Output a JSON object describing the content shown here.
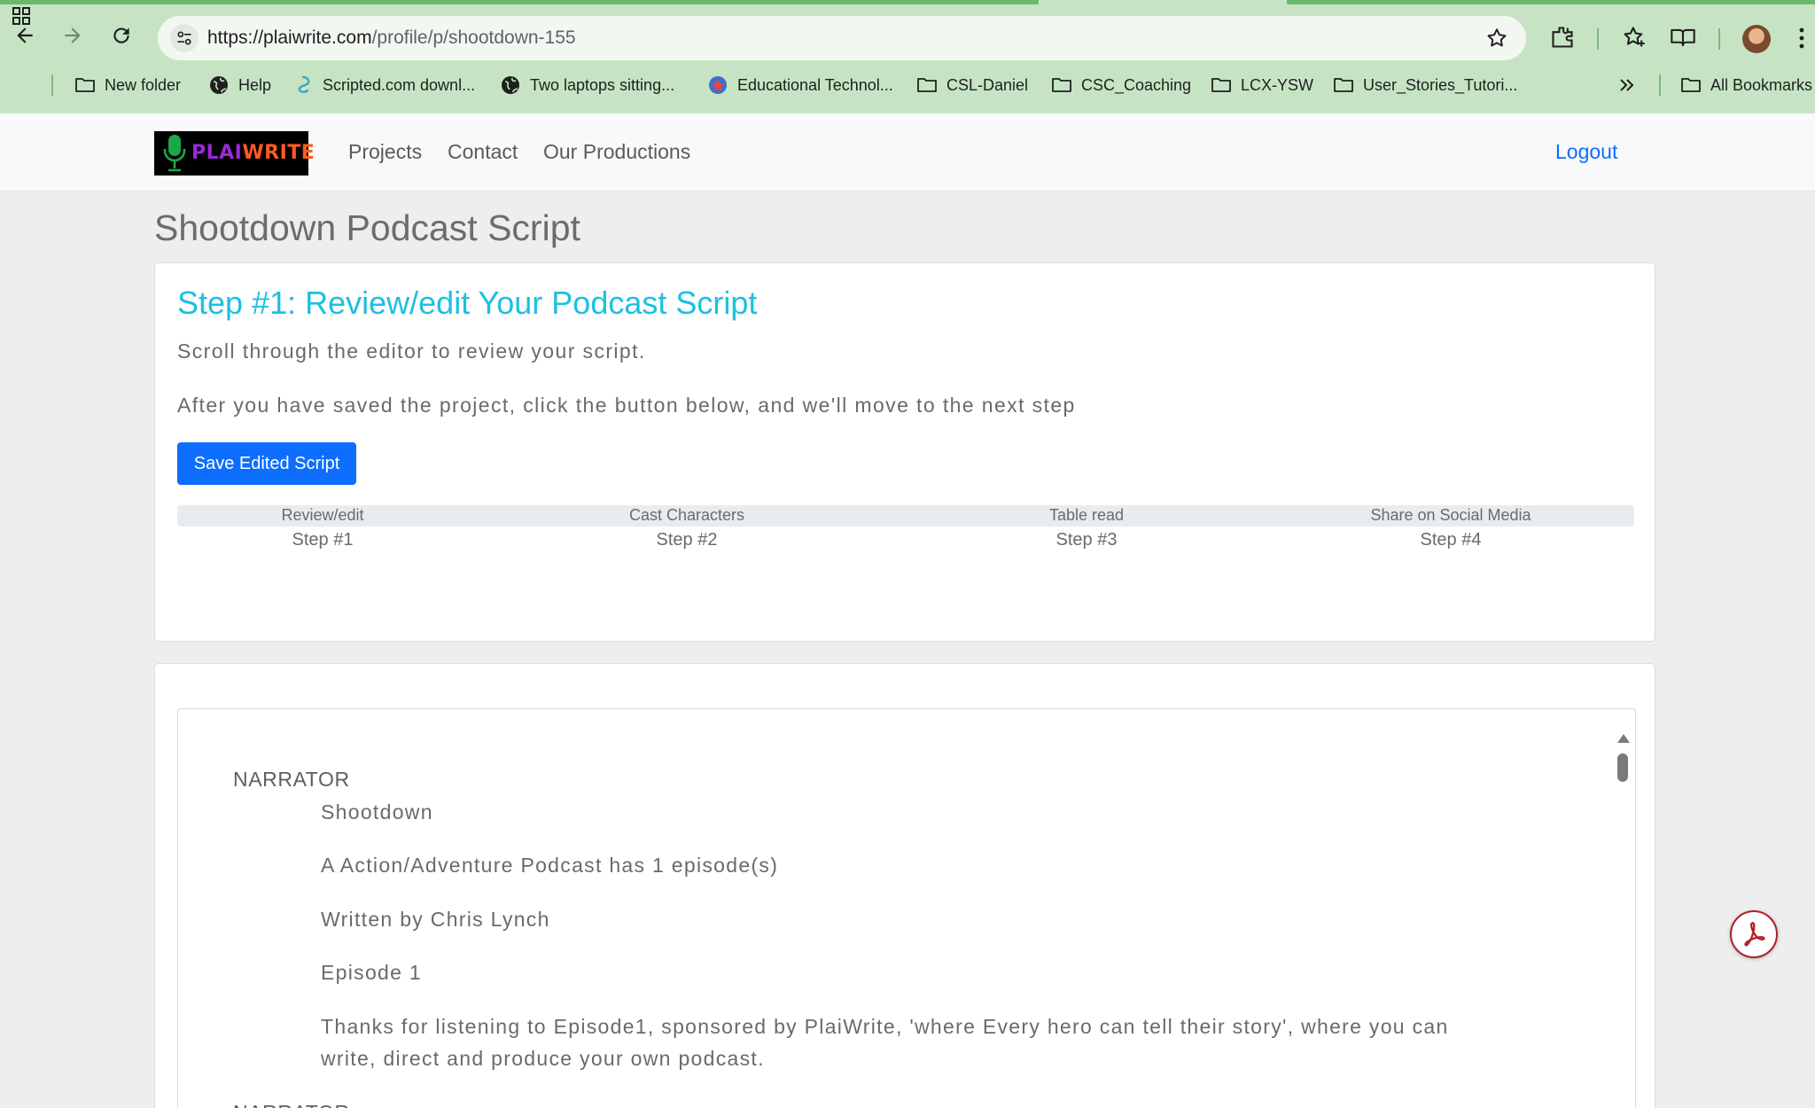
{
  "browser": {
    "url_host": "https://plaiwrite.com",
    "url_path": "/profile/p/shootdown-155",
    "bookmarks": [
      {
        "label": "New folder",
        "icon": "folder-icon"
      },
      {
        "label": "Help",
        "icon": "globe-icon"
      },
      {
        "label": "Scripted.com downl...",
        "icon": "scripted-icon"
      },
      {
        "label": "Two laptops sitting...",
        "icon": "globe-icon"
      },
      {
        "label": "Educational Technol...",
        "icon": "edtech-icon"
      },
      {
        "label": "CSL-Daniel",
        "icon": "folder-icon"
      },
      {
        "label": "CSC_Coaching",
        "icon": "folder-icon"
      },
      {
        "label": "LCX-YSW",
        "icon": "folder-icon"
      },
      {
        "label": "User_Stories_Tutori...",
        "icon": "folder-icon"
      },
      {
        "label": "All Bookmarks",
        "icon": "folder-icon"
      }
    ],
    "colors": {
      "chrome": "#c6e4c4",
      "accent": "#0d6efd"
    }
  },
  "nav": {
    "brand_part1": "PLAI",
    "brand_part2": "WRITE",
    "links": [
      "Projects",
      "Contact",
      "Our Productions"
    ],
    "logout": "Logout"
  },
  "page": {
    "title": "Shootdown Podcast Script",
    "step_heading": "Step #1: Review/edit Your Podcast Script",
    "instruction1": "Scroll through the editor to review your script.",
    "instruction2": "After you have saved the project, click the button below, and we'll move to the next step",
    "save_button": "Save Edited Script",
    "steps": [
      {
        "label": "Review/edit",
        "step": "Step #1"
      },
      {
        "label": "Cast Characters",
        "step": "Step #2"
      },
      {
        "label": "Table read",
        "step": "Step #3"
      },
      {
        "label": "Share on Social Media",
        "step": "Step #4"
      }
    ]
  },
  "script": {
    "speaker1": "NARRATOR",
    "lines": [
      "Shootdown",
      "A Action/Adventure Podcast has 1 episode(s)",
      "Written by Chris Lynch",
      "Episode 1",
      "Thanks for listening to Episode1, sponsored by PlaiWrite, 'where Every hero can tell their story', where you can write, direct and produce your own podcast."
    ],
    "speaker2": "NARRATOR"
  }
}
